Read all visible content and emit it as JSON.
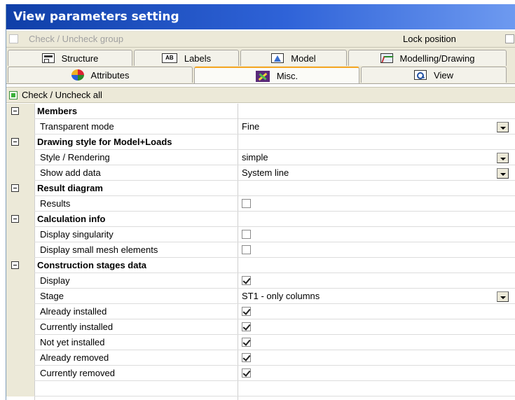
{
  "window": {
    "title": "View parameters setting"
  },
  "groupbar": {
    "check_group_label": "Check / Uncheck group",
    "lock_label": "Lock position"
  },
  "tabs": {
    "row1": [
      {
        "label": "Structure",
        "icon": "structure-icon"
      },
      {
        "label": "Labels",
        "icon": "labels-icon",
        "icon_text": "AB"
      },
      {
        "label": "Model",
        "icon": "model-icon"
      },
      {
        "label": "Modelling/Drawing",
        "icon": "modelling-drawing-icon"
      }
    ],
    "row2": [
      {
        "label": "Attributes",
        "icon": "attributes-icon"
      },
      {
        "label": "Misc.",
        "icon": "misc-icon",
        "active": true
      },
      {
        "label": "View",
        "icon": "view-icon"
      }
    ]
  },
  "check_all": {
    "label": "Check / Uncheck all"
  },
  "sections": [
    {
      "title": "Members",
      "rows": [
        {
          "label": "Transparent mode",
          "type": "select",
          "value": "Fine"
        }
      ]
    },
    {
      "title": "Drawing style for Model+Loads",
      "rows": [
        {
          "label": "Style / Rendering",
          "type": "select",
          "value": "simple"
        },
        {
          "label": "Show add data",
          "type": "select",
          "value": "System line"
        }
      ]
    },
    {
      "title": "Result diagram",
      "rows": [
        {
          "label": "Results",
          "type": "checkbox",
          "checked": false
        }
      ]
    },
    {
      "title": "Calculation info",
      "rows": [
        {
          "label": "Display singularity",
          "type": "checkbox",
          "checked": false
        },
        {
          "label": "Display small mesh elements",
          "type": "checkbox",
          "checked": false
        }
      ]
    },
    {
      "title": "Construction stages data",
      "rows": [
        {
          "label": "Display",
          "type": "checkbox",
          "checked": true
        },
        {
          "label": "Stage",
          "type": "select",
          "value": "ST1 - only columns"
        },
        {
          "label": "Already installed",
          "type": "checkbox",
          "checked": true
        },
        {
          "label": "Currently installed",
          "type": "checkbox",
          "checked": true
        },
        {
          "label": "Not yet installed",
          "type": "checkbox",
          "checked": true
        },
        {
          "label": "Already removed",
          "type": "checkbox",
          "checked": true
        },
        {
          "label": "Currently removed",
          "type": "checkbox",
          "checked": true
        }
      ]
    }
  ],
  "colors": {
    "title_start": "#0f3fa8",
    "title_end": "#6e9af0",
    "panel": "#ece9d8",
    "active_tab_accent": "#f5a623"
  }
}
